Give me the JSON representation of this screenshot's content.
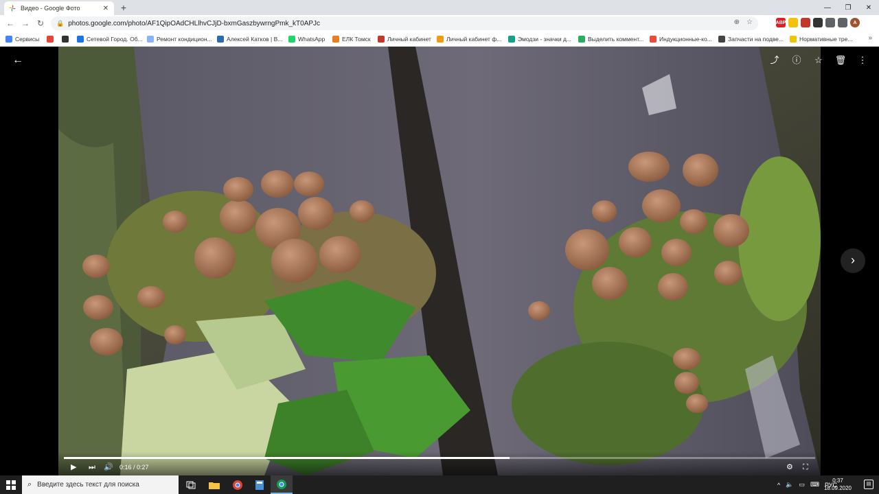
{
  "browser": {
    "tab_title": "Видео - Google Фото",
    "tab_close": "✕",
    "new_tab": "+",
    "window_controls": [
      "—",
      "❐",
      "✕"
    ],
    "url": "photos.google.com/photo/AF1QipOAdCHLlhvCJjD-bxmGaszbywrngPmk_kT0APJc",
    "nav": {
      "back": "←",
      "forward": "→",
      "reload": "↻"
    }
  },
  "extensions": [
    {
      "label": "ABP",
      "color": "#e31b23"
    },
    {
      "label": "",
      "color": "#f4c20d"
    },
    {
      "label": "",
      "color": "#c0392b"
    },
    {
      "label": "",
      "color": "#333333"
    },
    {
      "label": "",
      "color": "#5f6368"
    },
    {
      "label": "",
      "color": "#5f6368"
    },
    {
      "label": "A",
      "color": "#a0522d"
    }
  ],
  "bookmarks": [
    {
      "label": "Сервисы",
      "color": "#4285f4"
    },
    {
      "label": "",
      "color": "#ea4335"
    },
    {
      "label": "",
      "color": "#333333"
    },
    {
      "label": "Сетевой Город. Об...",
      "color": "#1a73e8"
    },
    {
      "label": "Ремонт кондицион...",
      "color": "#8ab4f8"
    },
    {
      "label": "Алексей Катков | В...",
      "color": "#2b6cb0"
    },
    {
      "label": "WhatsApp",
      "color": "#25d366"
    },
    {
      "label": "ЕЛК Томск",
      "color": "#e67e22"
    },
    {
      "label": "Личный кабинет",
      "color": "#c0392b"
    },
    {
      "label": "Личный кабинет ф...",
      "color": "#f39c12"
    },
    {
      "label": "Эмодзи - значки д...",
      "color": "#16a085"
    },
    {
      "label": "Выделить коммент...",
      "color": "#27ae60"
    },
    {
      "label": "Индукционные-ко...",
      "color": "#e74c3c"
    },
    {
      "label": "Запчасти на подве...",
      "color": "#444444"
    },
    {
      "label": "Нормативные тре...",
      "color": "#f1c40f"
    }
  ],
  "bookmarks_more": "»",
  "viewer": {
    "back_icon": "←",
    "top_icons": [
      "⤴",
      "ⓘ",
      "☆",
      "🗑",
      "⋮"
    ],
    "next_icon": "›"
  },
  "video": {
    "current_time": "0:16",
    "duration": "0:27",
    "time_display": "0:16 / 0:27",
    "progress_fraction": 0.593,
    "play_icon": "▶",
    "next_icon": "⏭",
    "volume_icon": "🔊",
    "settings_icon": "⚙",
    "fullscreen_icon": "⛶"
  },
  "taskbar": {
    "search_placeholder": "Введите здесь текст для поиска",
    "search_icon": "⌕",
    "language": "РУС",
    "time": "0:37",
    "date": "18.09.2020",
    "notification_icon": "▤"
  }
}
